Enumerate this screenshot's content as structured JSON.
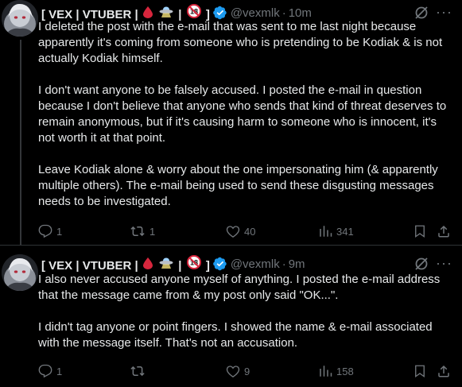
{
  "tweets": [
    {
      "display_name_prefix": "[ VEX | VTUBER |",
      "display_name_sep1": "|",
      "display_name_suffix": "]",
      "badge_18": "18",
      "handle": "@vexmlk",
      "dot": "·",
      "time": "10m",
      "paragraphs": [
        "I deleted the post with the e-mail that was sent to me last night because apparently it's coming from someone who is pretending to be Kodiak & is not actually Kodiak himself.",
        "I don't want anyone to be falsely accused. I posted the e-mail in question because I don't believe that anyone who sends that kind of threat deserves to remain anonymous, but if it's causing harm to someone who is innocent, it's not worth it at that point.",
        "Leave Kodiak alone & worry about the one impersonating him (& apparently multiple others). The e-mail being used to send these disgusting messages needs to be investigated."
      ],
      "replies": "1",
      "reposts": "1",
      "likes": "40",
      "views": "341"
    },
    {
      "display_name_prefix": "[ VEX | VTUBER |",
      "display_name_sep1": "|",
      "display_name_suffix": "]",
      "badge_18": "18",
      "handle": "@vexmlk",
      "dot": "·",
      "time": "9m",
      "paragraphs": [
        "I also never accused anyone myself of anything. I posted the e-mail address that the message came from & my post only said \"OK...\".",
        "I didn't tag anyone or point fingers. I showed the name & e-mail associated with the message itself. That's not an accusation."
      ],
      "replies": "1",
      "reposts": "",
      "likes": "9",
      "views": "158"
    }
  ],
  "colors": {
    "background": "#000000",
    "text": "#e7e9ea",
    "muted": "#71767b",
    "verified": "#1d9bf0",
    "thread_line": "#333639",
    "divider": "#2f3336"
  },
  "icons": [
    "avatar",
    "blood-drop-icon",
    "ufo-icon",
    "no-under-18-icon",
    "verified-badge-icon",
    "grok-icon",
    "more-icon",
    "reply-icon",
    "repost-icon",
    "like-icon",
    "views-icon",
    "bookmark-icon",
    "share-icon"
  ]
}
